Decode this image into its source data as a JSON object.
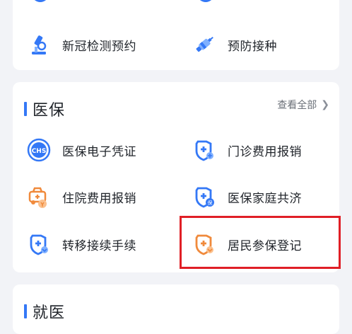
{
  "top_section": {
    "items": [
      {
        "label": "新冠检测预约",
        "icon": "microscope-icon"
      },
      {
        "label": "预防接种",
        "icon": "syringe-icon"
      }
    ]
  },
  "medical_insurance": {
    "title": "医保",
    "view_all": "查看全部",
    "items": [
      {
        "label": "医保电子凭证",
        "icon": "chs-badge-icon"
      },
      {
        "label": "门诊费用报销",
        "icon": "shield-plus-icon"
      },
      {
        "label": "住院费用报销",
        "icon": "ambulance-icon"
      },
      {
        "label": "医保家庭共济",
        "icon": "shield-bao-icon"
      },
      {
        "label": "转移接续手续",
        "icon": "shield-transfer-icon"
      },
      {
        "label": "居民参保登记",
        "icon": "shield-resident-icon"
      }
    ]
  },
  "medical_care": {
    "title": "就医"
  },
  "colors": {
    "accent_blue": "#3478f6",
    "orange": "#f08a3c",
    "highlight_red": "#e01f26"
  }
}
